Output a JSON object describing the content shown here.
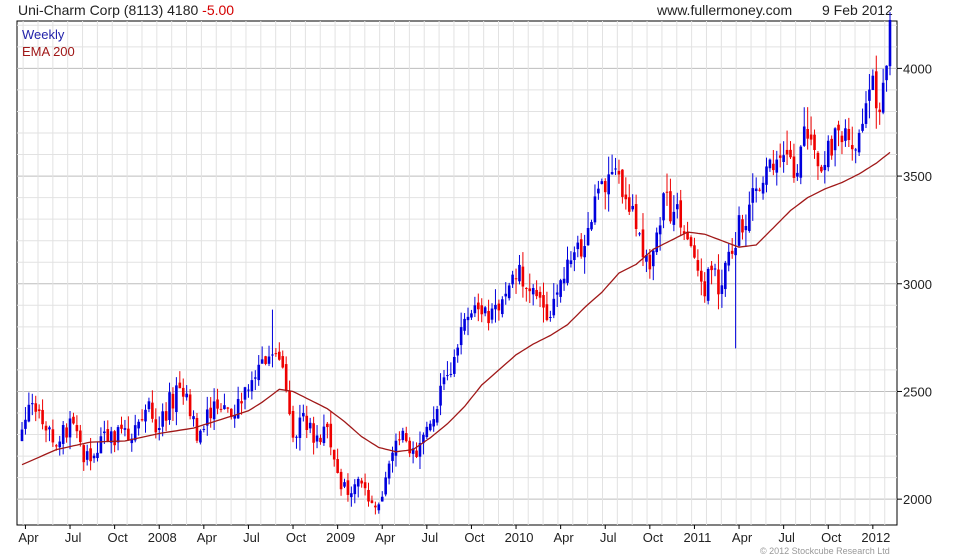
{
  "header": {
    "title": "Uni-Charm Corp (8113) 4180",
    "change": "-5.00",
    "site": "www.fullermoney.com",
    "date": "9 Feb 2012"
  },
  "legend": {
    "period": "Weekly",
    "ema": "EMA 200"
  },
  "copyright": "© 2012 Stockcube Research Ltd",
  "colors": {
    "up": "#0000dd",
    "down": "#ee0000",
    "ema": "#a01818",
    "grid": "#d8d8d8"
  },
  "chart_data": {
    "type": "candlestick",
    "title": "Uni-Charm Corp (8113) 4180 -5.00",
    "ylim": [
      1880,
      4220
    ],
    "y_ticks": [
      2000,
      2500,
      3000,
      3500,
      4000
    ],
    "x_ticks": [
      "Apr",
      "Jul",
      "Oct",
      "2008",
      "Apr",
      "Jul",
      "Oct",
      "2009",
      "Apr",
      "Jul",
      "Oct",
      "2010",
      "Apr",
      "Jul",
      "Oct",
      "2011",
      "Apr",
      "Jul",
      "Oct",
      "2012"
    ],
    "x_tick_t": [
      1,
      14,
      27,
      40,
      53,
      66,
      79,
      92,
      105,
      118,
      131,
      144,
      157,
      170,
      183,
      196,
      209,
      222,
      235,
      248
    ],
    "anchors": [
      [
        0,
        2280
      ],
      [
        1,
        2380
      ],
      [
        3,
        2470
      ],
      [
        6,
        2350
      ],
      [
        10,
        2260
      ],
      [
        14,
        2350
      ],
      [
        19,
        2180
      ],
      [
        24,
        2270
      ],
      [
        29,
        2310
      ],
      [
        33,
        2300
      ],
      [
        37,
        2420
      ],
      [
        40,
        2320
      ],
      [
        43,
        2450
      ],
      [
        47,
        2510
      ],
      [
        51,
        2300
      ],
      [
        53,
        2360
      ],
      [
        56,
        2450
      ],
      [
        61,
        2400
      ],
      [
        65,
        2500
      ],
      [
        68,
        2570
      ],
      [
        72,
        2700
      ],
      [
        76,
        2650
      ],
      [
        79,
        2250
      ],
      [
        82,
        2400
      ],
      [
        85,
        2270
      ],
      [
        89,
        2300
      ],
      [
        92,
        2100
      ],
      [
        95,
        2030
      ],
      [
        98,
        2100
      ],
      [
        102,
        1960
      ],
      [
        105,
        2040
      ],
      [
        108,
        2230
      ],
      [
        111,
        2280
      ],
      [
        114,
        2200
      ],
      [
        117,
        2300
      ],
      [
        120,
        2400
      ],
      [
        123,
        2550
      ],
      [
        126,
        2660
      ],
      [
        129,
        2850
      ],
      [
        132,
        2900
      ],
      [
        135,
        2860
      ],
      [
        138,
        2900
      ],
      [
        141,
        2950
      ],
      [
        144,
        3050
      ],
      [
        147,
        2990
      ],
      [
        150,
        3000
      ],
      [
        153,
        2870
      ],
      [
        156,
        2950
      ],
      [
        159,
        3070
      ],
      [
        162,
        3150
      ],
      [
        165,
        3220
      ],
      [
        168,
        3500
      ],
      [
        171,
        3450
      ],
      [
        174,
        3480
      ],
      [
        177,
        3370
      ],
      [
        180,
        3200
      ],
      [
        183,
        3100
      ],
      [
        185,
        3200
      ],
      [
        187,
        3380
      ],
      [
        189,
        3340
      ],
      [
        192,
        3300
      ],
      [
        194,
        3200
      ],
      [
        197,
        3100
      ],
      [
        199,
        3000
      ],
      [
        201,
        3120
      ],
      [
        203,
        3000
      ],
      [
        205,
        3060
      ],
      [
        207,
        3150
      ],
      [
        209,
        3280
      ],
      [
        212,
        3330
      ],
      [
        215,
        3500
      ],
      [
        218,
        3550
      ],
      [
        221,
        3600
      ],
      [
        223,
        3580
      ],
      [
        225,
        3520
      ],
      [
        227,
        3620
      ],
      [
        229,
        3700
      ],
      [
        231,
        3600
      ],
      [
        233,
        3560
      ],
      [
        235,
        3620
      ],
      [
        238,
        3680
      ],
      [
        241,
        3650
      ],
      [
        244,
        3640
      ],
      [
        246,
        3800
      ],
      [
        248,
        3900
      ],
      [
        250,
        3860
      ],
      [
        252,
        4000
      ],
      [
        253,
        4180
      ]
    ],
    "ema_points": [
      [
        0,
        2160
      ],
      [
        10,
        2230
      ],
      [
        20,
        2265
      ],
      [
        30,
        2270
      ],
      [
        40,
        2305
      ],
      [
        50,
        2330
      ],
      [
        60,
        2380
      ],
      [
        66,
        2410
      ],
      [
        70,
        2450
      ],
      [
        75,
        2510
      ],
      [
        79,
        2500
      ],
      [
        84,
        2460
      ],
      [
        89,
        2420
      ],
      [
        94,
        2360
      ],
      [
        99,
        2290
      ],
      [
        104,
        2240
      ],
      [
        109,
        2220
      ],
      [
        114,
        2230
      ],
      [
        119,
        2285
      ],
      [
        124,
        2350
      ],
      [
        129,
        2430
      ],
      [
        134,
        2530
      ],
      [
        139,
        2600
      ],
      [
        144,
        2670
      ],
      [
        149,
        2720
      ],
      [
        154,
        2760
      ],
      [
        159,
        2810
      ],
      [
        164,
        2890
      ],
      [
        169,
        2960
      ],
      [
        174,
        3050
      ],
      [
        179,
        3090
      ],
      [
        184,
        3160
      ],
      [
        189,
        3200
      ],
      [
        194,
        3240
      ],
      [
        199,
        3230
      ],
      [
        204,
        3200
      ],
      [
        209,
        3170
      ],
      [
        214,
        3180
      ],
      [
        219,
        3260
      ],
      [
        224,
        3340
      ],
      [
        229,
        3400
      ],
      [
        234,
        3440
      ],
      [
        239,
        3470
      ],
      [
        244,
        3510
      ],
      [
        249,
        3560
      ],
      [
        253,
        3610
      ]
    ],
    "spikes": [
      {
        "t": 208,
        "low": 2700
      },
      {
        "t": 73,
        "high": 2880
      },
      {
        "t": 229,
        "high": 3820
      }
    ]
  }
}
